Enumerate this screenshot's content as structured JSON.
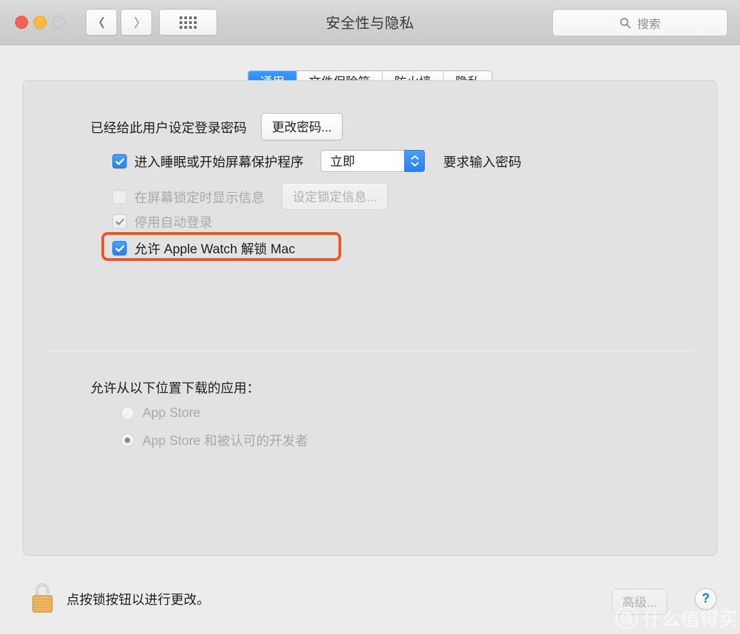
{
  "window": {
    "title": "安全性与隐私",
    "traffic_lights": [
      "close",
      "minimize",
      "zoom"
    ],
    "nav": {
      "back": "‹",
      "forward": "›",
      "grid": "show-all"
    },
    "search": {
      "placeholder": "搜索",
      "value": ""
    }
  },
  "tabs": [
    {
      "label": "通用",
      "active": true
    },
    {
      "label": "文件保险箱",
      "active": false
    },
    {
      "label": "防火墙",
      "active": false
    },
    {
      "label": "隐私",
      "active": false
    }
  ],
  "general": {
    "password_status": "已经给此用户设定登录密码",
    "change_password_button": "更改密码...",
    "options": [
      {
        "label": "进入睡眠或开始屏幕保护程序",
        "checked": true,
        "enabled": true,
        "select_value": "立即",
        "suffix": "要求输入密码"
      },
      {
        "label": "在屏幕锁定时显示信息",
        "checked": false,
        "enabled": false,
        "button": "设定锁定信息..."
      },
      {
        "label": "停用自动登录",
        "checked": true,
        "enabled": false
      },
      {
        "label": "允许 Apple Watch 解锁 Mac",
        "checked": true,
        "enabled": true,
        "highlighted": true
      }
    ]
  },
  "download_section": {
    "title": "允许从以下位置下载的应用：",
    "options": [
      {
        "label": "App Store",
        "selected": false,
        "enabled": false
      },
      {
        "label": "App Store 和被认可的开发者",
        "selected": true,
        "enabled": false
      }
    ]
  },
  "footer": {
    "lock_state": "unlocked",
    "message": "点按锁按钮以进行更改。",
    "advanced_button": "高级...",
    "help_button": "?"
  },
  "watermark": {
    "logo": "值",
    "text": "什么值得买"
  },
  "colors": {
    "accent_blue": "#2a82ef",
    "highlight_orange": "#f4521f",
    "window_bg": "#ececec",
    "panel_bg": "#e2e2e2"
  }
}
